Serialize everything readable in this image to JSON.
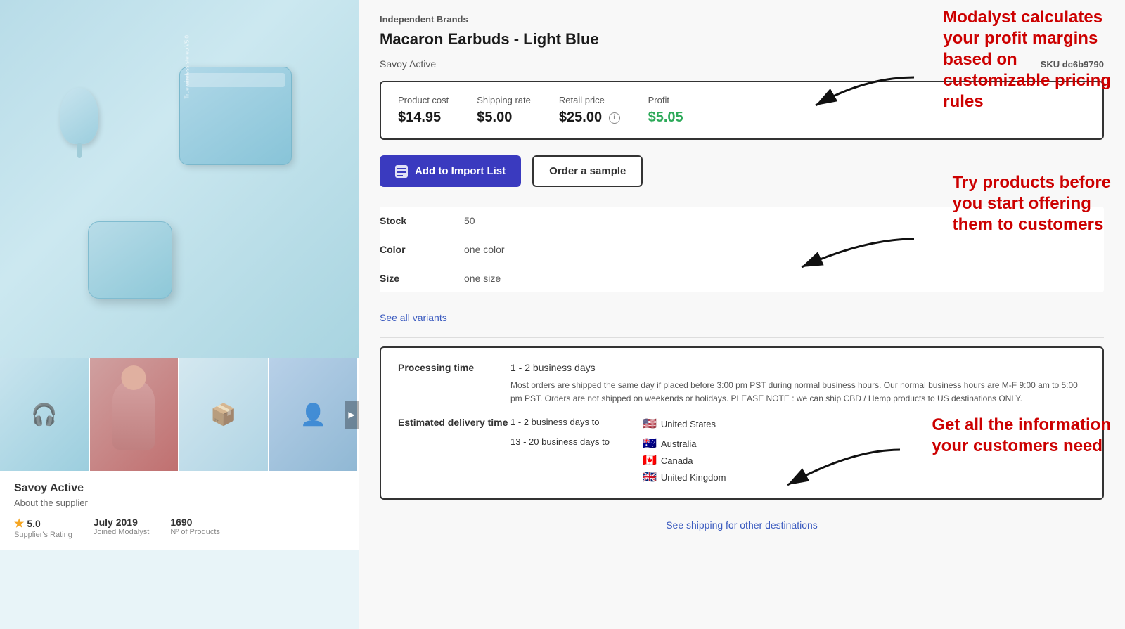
{
  "product": {
    "brand": "Independent Brands",
    "title": "Macaron Earbuds - Light Blue",
    "supplier": "Savoy Active",
    "sku_label": "SKU",
    "sku_value": "dc6b9790",
    "pricing": {
      "product_cost_label": "Product cost",
      "product_cost_value": "$14.95",
      "shipping_rate_label": "Shipping rate",
      "shipping_rate_value": "$5.00",
      "retail_price_label": "Retail price",
      "retail_price_value": "$25.00",
      "profit_label": "Profit",
      "profit_value": "$5.05"
    },
    "buttons": {
      "add_to_import": "Add to Import List",
      "order_sample": "Order a sample"
    },
    "details": {
      "stock_label": "Stock",
      "stock_value": "50",
      "color_label": "Color",
      "color_value": "one color",
      "size_label": "Size",
      "size_value": "one size",
      "see_variants": "See all variants"
    },
    "shipping": {
      "processing_time_label": "Processing time",
      "processing_time_value": "1 - 2 business days",
      "processing_note": "Most orders are shipped the same day if placed before 3:00 pm PST during normal business hours. Our normal business hours are M-F 9:00 am to 5:00 pm PST. Orders are not shipped on weekends or holidays. PLEASE NOTE : we can ship CBD / Hemp products to US destinations ONLY.",
      "estimated_delivery_label": "Estimated delivery time",
      "delivery_rows": [
        {
          "time": "1 - 2 business days to",
          "destinations": [
            {
              "flag": "🇺🇸",
              "name": "United States"
            }
          ]
        },
        {
          "time": "13 - 20 business days to",
          "destinations": [
            {
              "flag": "🇦🇺",
              "name": "Australia"
            },
            {
              "flag": "🇨🇦",
              "name": "Canada"
            },
            {
              "flag": "🇬🇧",
              "name": "United Kingdom"
            }
          ]
        }
      ],
      "see_shipping": "See shipping for other destinations"
    }
  },
  "supplier": {
    "name": "Savoy Active",
    "about": "About the supplier",
    "rating_value": "5.0",
    "rating_label": "Supplier's Rating",
    "joined_label": "Joined Modalyst",
    "joined_value": "July 2019",
    "products_label": "Nº of Products",
    "products_value": "1690"
  },
  "annotations": {
    "text1": "Modalyst calculates\nyour profit margins\nbased on\ncustomizable pricing\nrules",
    "text2": "Try products before\nyou start offering\nthem to customers",
    "text3": "Get all the information\nyour customers need"
  }
}
